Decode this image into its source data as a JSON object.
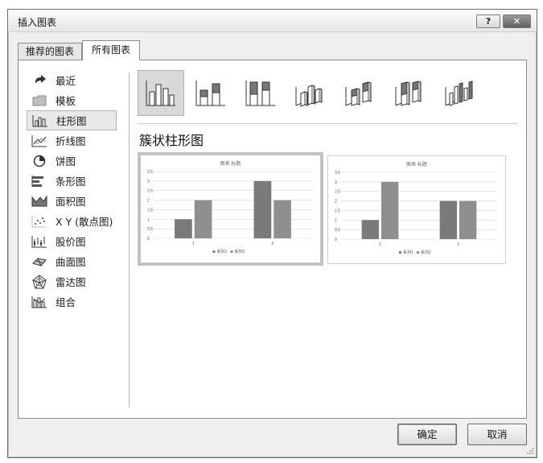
{
  "window": {
    "title": "插入图表",
    "help_label": "?",
    "close_label": "✕"
  },
  "tabs": [
    {
      "label": "推荐的图表",
      "active": false
    },
    {
      "label": "所有图表",
      "active": true
    }
  ],
  "sidebar": {
    "selected_index": 2,
    "items": [
      {
        "label": "最近",
        "icon": "recent-icon"
      },
      {
        "label": "模板",
        "icon": "folder-icon"
      },
      {
        "label": "柱形图",
        "icon": "column-chart-icon"
      },
      {
        "label": "折线图",
        "icon": "line-chart-icon"
      },
      {
        "label": "饼图",
        "icon": "pie-chart-icon"
      },
      {
        "label": "条形图",
        "icon": "bar-chart-icon"
      },
      {
        "label": "面积图",
        "icon": "area-chart-icon"
      },
      {
        "label": "X Y (散点图)",
        "icon": "scatter-chart-icon"
      },
      {
        "label": "股价图",
        "icon": "stock-chart-icon"
      },
      {
        "label": "曲面图",
        "icon": "surface-chart-icon"
      },
      {
        "label": "雷达图",
        "icon": "radar-chart-icon"
      },
      {
        "label": "组合",
        "icon": "combo-chart-icon"
      }
    ]
  },
  "chart_subtypes": [
    {
      "icon": "clustered-column-icon",
      "selected": true
    },
    {
      "icon": "stacked-column-icon",
      "selected": false
    },
    {
      "icon": "100-stacked-column-icon",
      "selected": false
    },
    {
      "icon": "3d-clustered-column-icon",
      "selected": false
    },
    {
      "icon": "3d-stacked-column-icon",
      "selected": false
    },
    {
      "icon": "3d-100-stacked-column-icon",
      "selected": false
    },
    {
      "icon": "3d-column-icon",
      "selected": false
    }
  ],
  "subtype_title": "簇状柱形图",
  "chart_data": [
    {
      "type": "bar",
      "title": "图表 标题",
      "categories": [
        "1",
        "2"
      ],
      "series": [
        {
          "name": "系列1",
          "values": [
            1,
            3
          ]
        },
        {
          "name": "系列2",
          "values": [
            2,
            2
          ]
        }
      ],
      "ylim": [
        0,
        3.5
      ],
      "yticks": [
        "0",
        "0.5",
        "1",
        "1.5",
        "2",
        "2.5",
        "3",
        "3.5"
      ],
      "grid": true,
      "legend": "bottom"
    },
    {
      "type": "bar",
      "title": "图表 标题",
      "categories": [
        "1",
        "2"
      ],
      "series": [
        {
          "name": "系列1",
          "values": [
            1,
            2
          ]
        },
        {
          "name": "系列2",
          "values": [
            3,
            2
          ]
        }
      ],
      "ylim": [
        0,
        3.5
      ],
      "yticks": [
        "0",
        "0.5",
        "1",
        "1.5",
        "2",
        "2.5",
        "3",
        "3.5"
      ],
      "grid": true,
      "legend": "bottom"
    }
  ],
  "buttons": {
    "ok": "确定",
    "cancel": "取消"
  },
  "colors": {
    "series1": "#7a7a7a",
    "series2": "#8f8f8f",
    "selected_bg": "#d9d9d9"
  }
}
